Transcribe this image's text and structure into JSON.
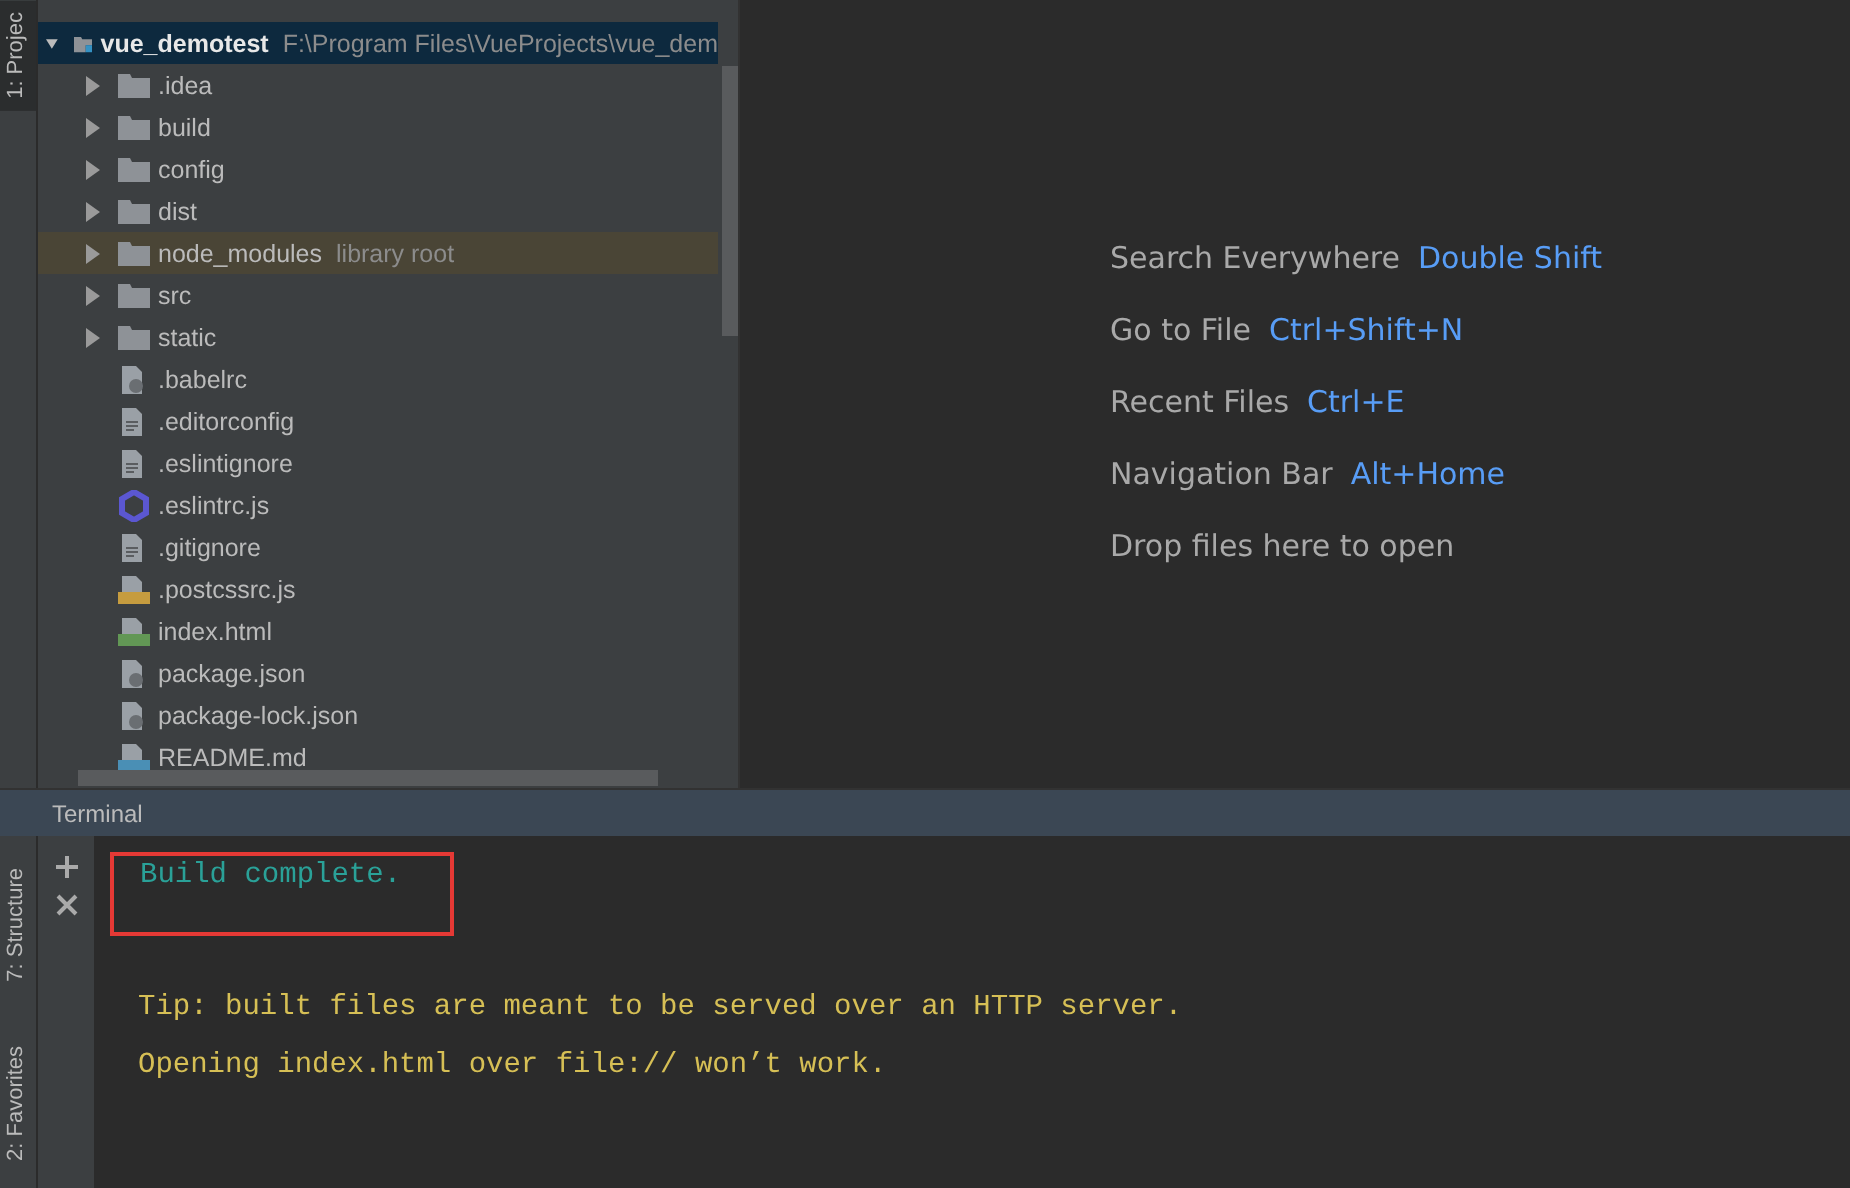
{
  "left_stripe": [
    {
      "label": "1: Projec",
      "selected": true
    },
    {
      "label": "7: Structure",
      "selected": false
    },
    {
      "label": "2: Favorites",
      "selected": false
    }
  ],
  "project_tree": {
    "root": {
      "name": "vue_demotest",
      "path": "F:\\Program Files\\VueProjects\\vue_dem",
      "expanded": true,
      "selected": true
    },
    "children": [
      {
        "name": ".idea",
        "kind": "folder",
        "expanded": false,
        "highlighted": false
      },
      {
        "name": "build",
        "kind": "folder",
        "expanded": false,
        "highlighted": false
      },
      {
        "name": "config",
        "kind": "folder",
        "expanded": false,
        "highlighted": false
      },
      {
        "name": "dist",
        "kind": "folder",
        "expanded": false,
        "highlighted": false
      },
      {
        "name": "node_modules",
        "note": "library root",
        "kind": "folder",
        "expanded": false,
        "highlighted": true
      },
      {
        "name": "src",
        "kind": "folder",
        "expanded": false,
        "highlighted": false
      },
      {
        "name": "static",
        "kind": "folder",
        "expanded": false,
        "highlighted": false
      },
      {
        "name": ".babelrc",
        "kind": "config",
        "highlighted": false
      },
      {
        "name": ".editorconfig",
        "kind": "text",
        "highlighted": false
      },
      {
        "name": ".eslintignore",
        "kind": "text",
        "highlighted": false
      },
      {
        "name": ".eslintrc.js",
        "kind": "eslint",
        "highlighted": false
      },
      {
        "name": ".gitignore",
        "kind": "text",
        "highlighted": false
      },
      {
        "name": ".postcssrc.js",
        "kind": "js",
        "highlighted": false
      },
      {
        "name": "index.html",
        "kind": "html",
        "highlighted": false
      },
      {
        "name": "package.json",
        "kind": "config",
        "highlighted": false
      },
      {
        "name": "package-lock.json",
        "kind": "config",
        "highlighted": false
      },
      {
        "name": "README.md",
        "kind": "md",
        "highlighted": false
      }
    ]
  },
  "editor_hints": [
    {
      "label": "Search Everywhere",
      "shortcut": "Double Shift"
    },
    {
      "label": "Go to File",
      "shortcut": "Ctrl+Shift+N"
    },
    {
      "label": "Recent Files",
      "shortcut": "Ctrl+E"
    },
    {
      "label": "Navigation Bar",
      "shortcut": "Alt+Home"
    },
    {
      "label": "Drop files here to open"
    }
  ],
  "terminal": {
    "title": "Terminal",
    "lines": [
      {
        "text": "Build complete.",
        "kind": "success",
        "boxed": true
      },
      {
        "text": "Tip: built files are meant to be served over an HTTP server.",
        "kind": "warning",
        "boxed": false
      },
      {
        "text": "Opening index.html over file:// won’t work.",
        "kind": "warning",
        "boxed": false
      }
    ]
  }
}
